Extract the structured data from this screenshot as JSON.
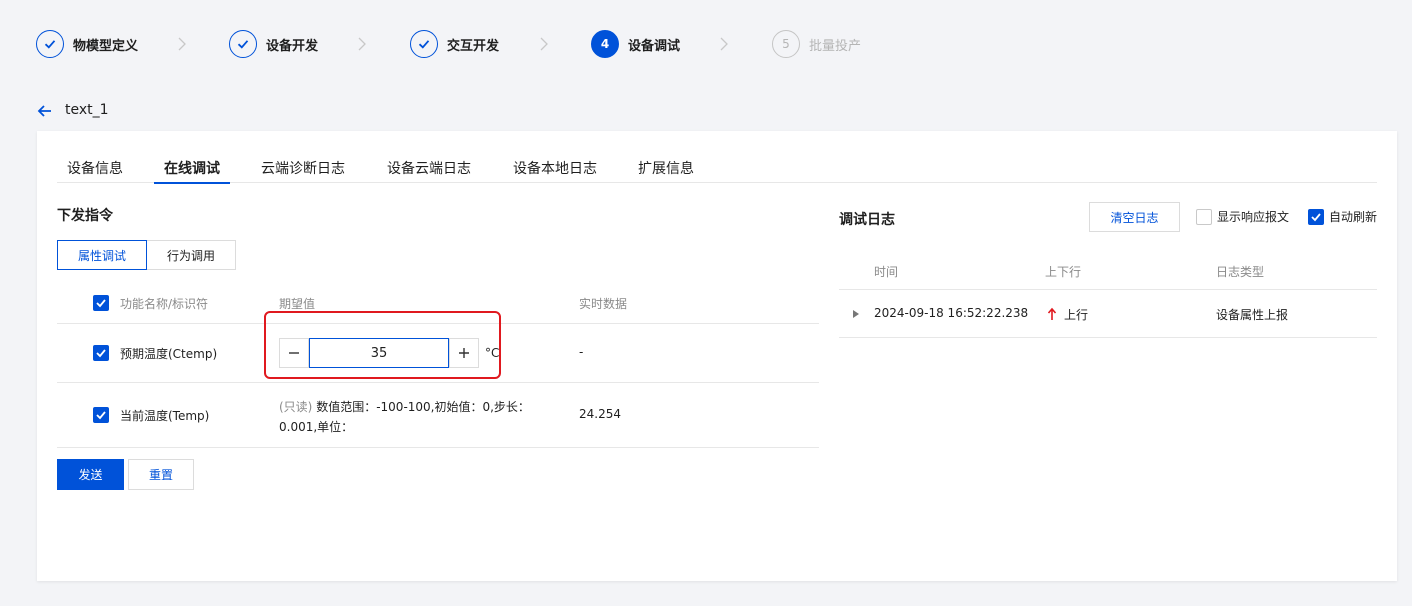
{
  "steps": [
    {
      "label": "物模型定义",
      "state": "done"
    },
    {
      "label": "设备开发",
      "state": "done"
    },
    {
      "label": "交互开发",
      "state": "done"
    },
    {
      "label": "设备调试",
      "state": "active",
      "number": "4"
    },
    {
      "label": "批量投产",
      "state": "pending",
      "number": "5"
    }
  ],
  "header": {
    "device_name": "text_1"
  },
  "tabs": [
    "设备信息",
    "在线调试",
    "云端诊断日志",
    "设备云端日志",
    "设备本地日志",
    "扩展信息"
  ],
  "active_tab": "在线调试",
  "command": {
    "title": "下发指令",
    "segments": [
      "属性调试",
      "行为调用"
    ],
    "active_segment": "属性调试",
    "columns": [
      "功能名称/标识符",
      "期望值",
      "实时数据"
    ],
    "rows": [
      {
        "name": "预期温度(Ctemp)",
        "checked": true,
        "value": "35",
        "unit": "°C",
        "realtime": "-"
      },
      {
        "name": "当前温度(Temp)",
        "checked": true,
        "readonly_tag": "(只读)",
        "desc": "数值范围：-100-100,初始值：0,步长：0.001,单位：",
        "realtime": "24.254"
      }
    ],
    "send_label": "发送",
    "reset_label": "重置"
  },
  "log": {
    "title": "调试日志",
    "clear_label": "清空日志",
    "show_response_label": "显示响应报文",
    "show_response_checked": false,
    "auto_refresh_label": "自动刷新",
    "auto_refresh_checked": true,
    "columns": [
      "时间",
      "上下行",
      "日志类型"
    ],
    "rows": [
      {
        "time": "2024-09-18 16:52:22.238",
        "direction": "上行",
        "type": "设备属性上报"
      }
    ]
  },
  "colors": {
    "accent": "#0052d9",
    "highlight": "#e0191f",
    "up_arrow": "#e0191f"
  }
}
